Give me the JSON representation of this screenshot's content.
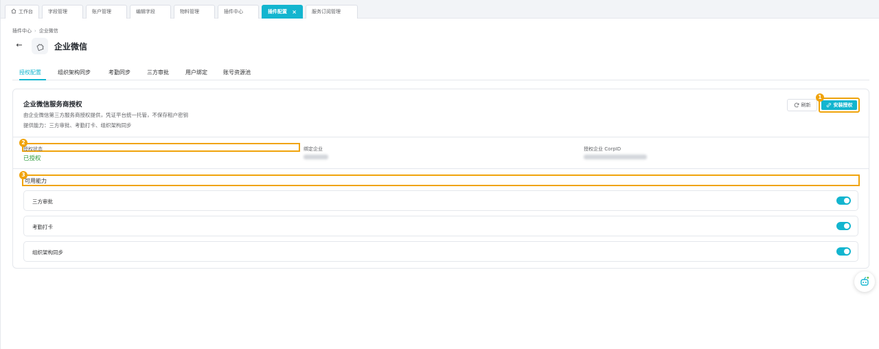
{
  "tabs": [
    {
      "label": "工作台",
      "icon": "home-icon"
    },
    {
      "label": "字段管理"
    },
    {
      "label": "账户管理"
    },
    {
      "label": "编辑字段"
    },
    {
      "label": "物料管理"
    },
    {
      "label": "插件中心"
    },
    {
      "label": "插件配置",
      "active": true,
      "close": "×"
    },
    {
      "label": "服务订阅管理"
    }
  ],
  "breadcrumb": {
    "parent": "插件中心",
    "sep": "›",
    "current": "企业微信"
  },
  "header": {
    "back": "←",
    "title": "企业微信"
  },
  "subtabs": [
    "授权配置",
    "组织架构同步",
    "考勤同步",
    "三方审批",
    "用户绑定",
    "账号资源池"
  ],
  "card": {
    "title": "企业微信服务商授权",
    "desc1": "由企业微信第三方服务商授权提供，凭证平台统一托管，不保存租户密钥",
    "desc2": "提供能力：三方审批、考勤打卡、组织架构同步",
    "refresh_label": "刷新",
    "install_label": "安装授权",
    "info": {
      "status_label": "授权状态",
      "status_value": "已授权",
      "company_label": "绑定企业",
      "corpid_label": "授权企业 CorpID"
    },
    "capabilities_label": "可用能力",
    "capabilities": [
      {
        "label": "三方审批",
        "enabled": true
      },
      {
        "label": "考勤打卡",
        "enabled": true
      },
      {
        "label": "组织架构同步",
        "enabled": true
      }
    ]
  },
  "markers": [
    "1",
    "2",
    "3"
  ],
  "colors": {
    "accent": "#13b5cf",
    "highlight": "#f0a30a",
    "success": "#2e9b3e"
  }
}
